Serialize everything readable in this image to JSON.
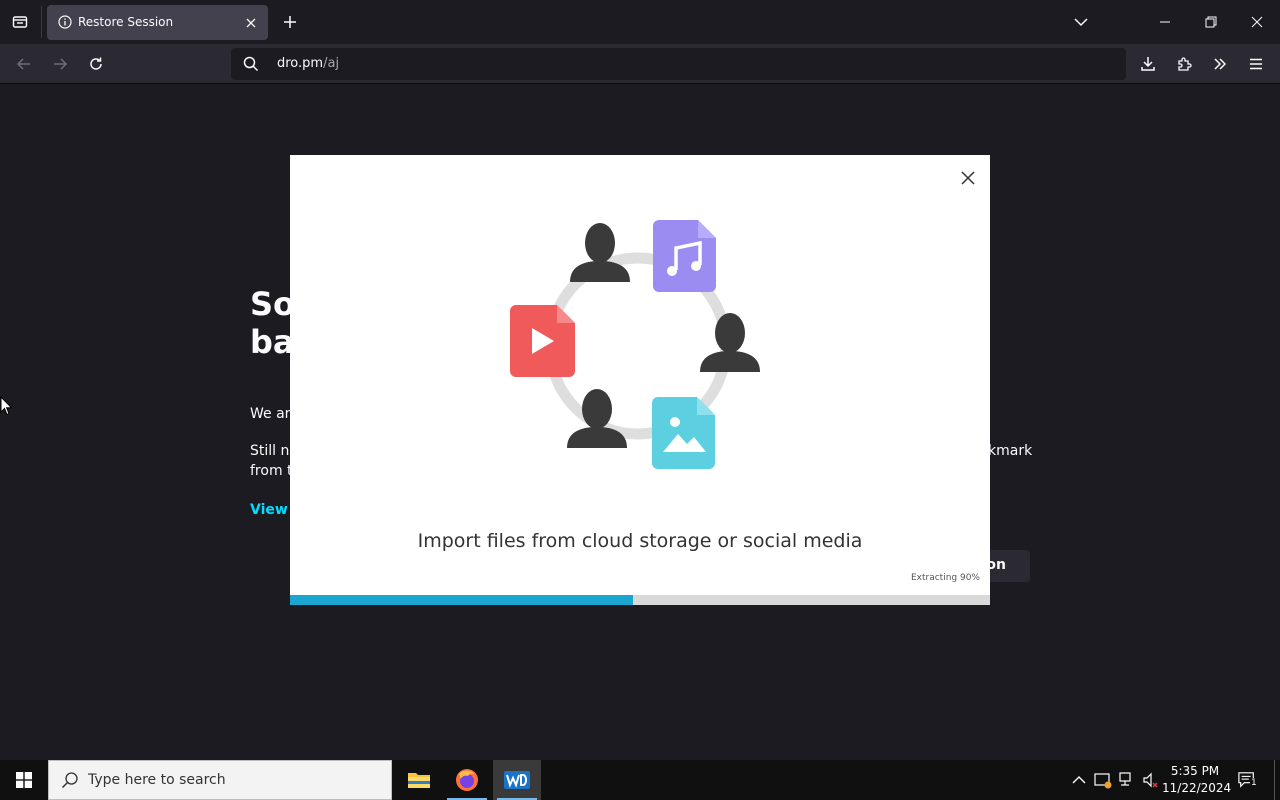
{
  "browser": {
    "tab": {
      "title": "Restore Session"
    },
    "url": {
      "host": "dro.pm",
      "path": "/aj"
    }
  },
  "background_page": {
    "heading_line1": "So",
    "heading_line2": "bac",
    "para1": "We are",
    "para2_line1": "Still no",
    "para2_line1_end": "kmark",
    "para2_line2": "from t",
    "link": "View l",
    "restore_button": "on"
  },
  "modal": {
    "caption": "Import files from cloud storage or social media",
    "status": "Extracting 90%",
    "progress": 0.49,
    "colors": {
      "progress_fill": "#1ba6d1",
      "music_file": "#9b8cf2",
      "video_file": "#f05a5a",
      "image_file": "#5ccfe0"
    }
  },
  "taskbar": {
    "search_placeholder": "Type here to search",
    "time": "5:35 PM",
    "date": "11/22/2024",
    "notification_count": "1",
    "apps": [
      "file-explorer",
      "firefox",
      "wd-app"
    ]
  }
}
